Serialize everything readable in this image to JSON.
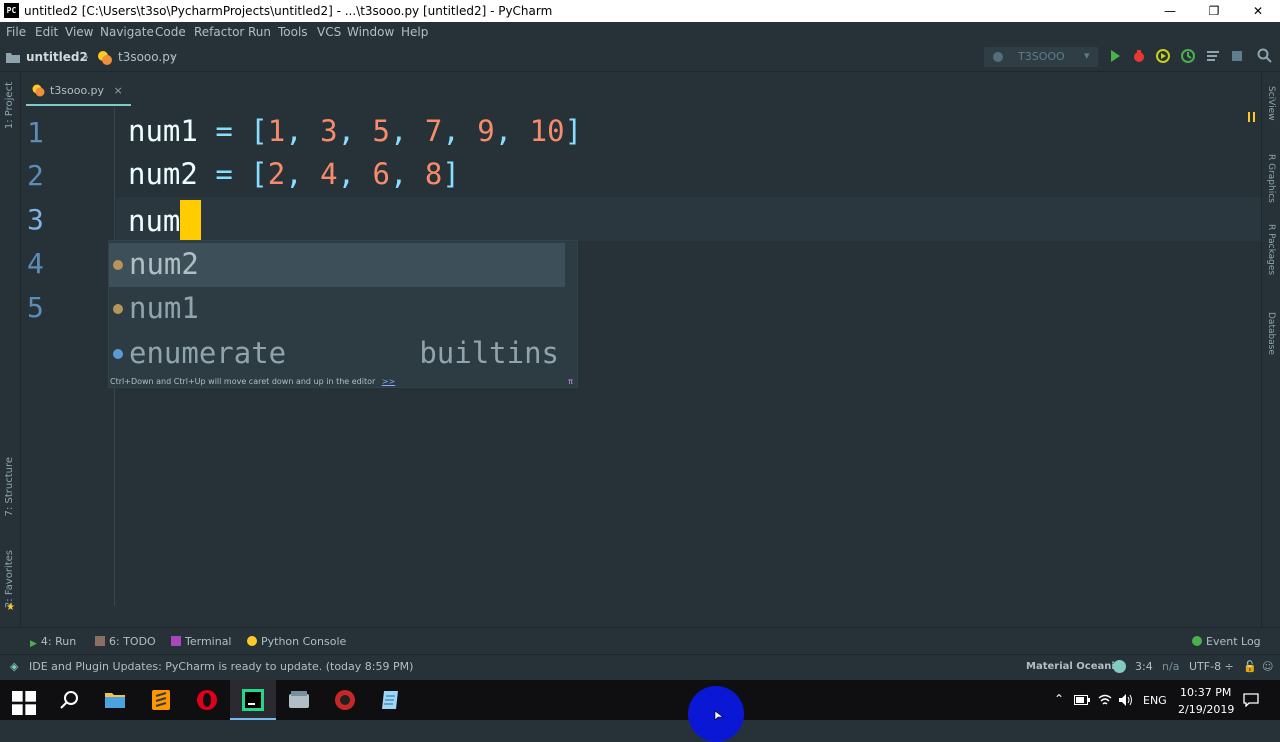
{
  "window": {
    "app_icon_text": "PC",
    "title": "untitled2 [C:\\Users\\t3so\\PycharmProjects\\untitled2] - ...\\t3sooo.py [untitled2] - PyCharm",
    "controls": {
      "minimize": "—",
      "maximize": "❐",
      "close": "✕"
    }
  },
  "menu": [
    {
      "label": "File"
    },
    {
      "label": "Edit"
    },
    {
      "label": "View"
    },
    {
      "label": "Navigate"
    },
    {
      "label": "Code"
    },
    {
      "label": "Refactor"
    },
    {
      "label": "Run"
    },
    {
      "label": "Tools"
    },
    {
      "label": "VCS"
    },
    {
      "label": "Window"
    },
    {
      "label": "Help"
    }
  ],
  "breadcrumb": {
    "project": "untitled2",
    "file": "t3sooo.py"
  },
  "run_config": {
    "name": "T3SOOO"
  },
  "left_strip": {
    "project": "1: Project",
    "structure": "7: Structure",
    "favorites": "2: Favorites"
  },
  "right_strip": {
    "sciview": "SciView",
    "r_graphics": "R Graphics",
    "r_packages": "R Packages",
    "database": "Database"
  },
  "editor": {
    "tab_label": "t3sooo.py",
    "tab_close": "×",
    "lines": [
      {
        "no": "1",
        "var": "num1",
        "eq": "=",
        "open": "[",
        "items": [
          "1",
          "3",
          "5",
          "7",
          "9",
          "10"
        ],
        "close": "]"
      },
      {
        "no": "2",
        "var": "num2",
        "eq": "=",
        "open": "[",
        "items": [
          "2",
          "4",
          "6",
          "8"
        ],
        "close": "]"
      },
      {
        "no": "3",
        "text": "num"
      },
      {
        "no": "4"
      },
      {
        "no": "5"
      }
    ]
  },
  "completion": {
    "items": [
      {
        "label": "num2",
        "type": "",
        "selected": true
      },
      {
        "label": "num1",
        "type": ""
      },
      {
        "label": "enumerate",
        "type": "builtins"
      }
    ],
    "hint": "Ctrl+Down and Ctrl+Up will move caret down and up in the editor",
    "hint_link": ">>",
    "hint_pin": "π"
  },
  "bottom_tools": {
    "run": "4: Run",
    "todo": "6: TODO",
    "terminal": "Terminal",
    "python_console": "Python Console",
    "event_log": "Event Log"
  },
  "status": {
    "message": "IDE and Plugin Updates: PyCharm is ready to update. (today 8:59 PM)",
    "theme": "Material Oceanic",
    "position": "3:4",
    "na": "n/a",
    "encoding": "UTF-8 ÷"
  },
  "taskbar": {
    "language": "ENG",
    "time": "10:37 PM",
    "date": "2/19/2019"
  },
  "colors": {
    "background": "#263238",
    "number": "#f78c6c",
    "bracket": "#89ddff",
    "caret": "#ffcc00",
    "line_number": "#5c8cb8"
  }
}
